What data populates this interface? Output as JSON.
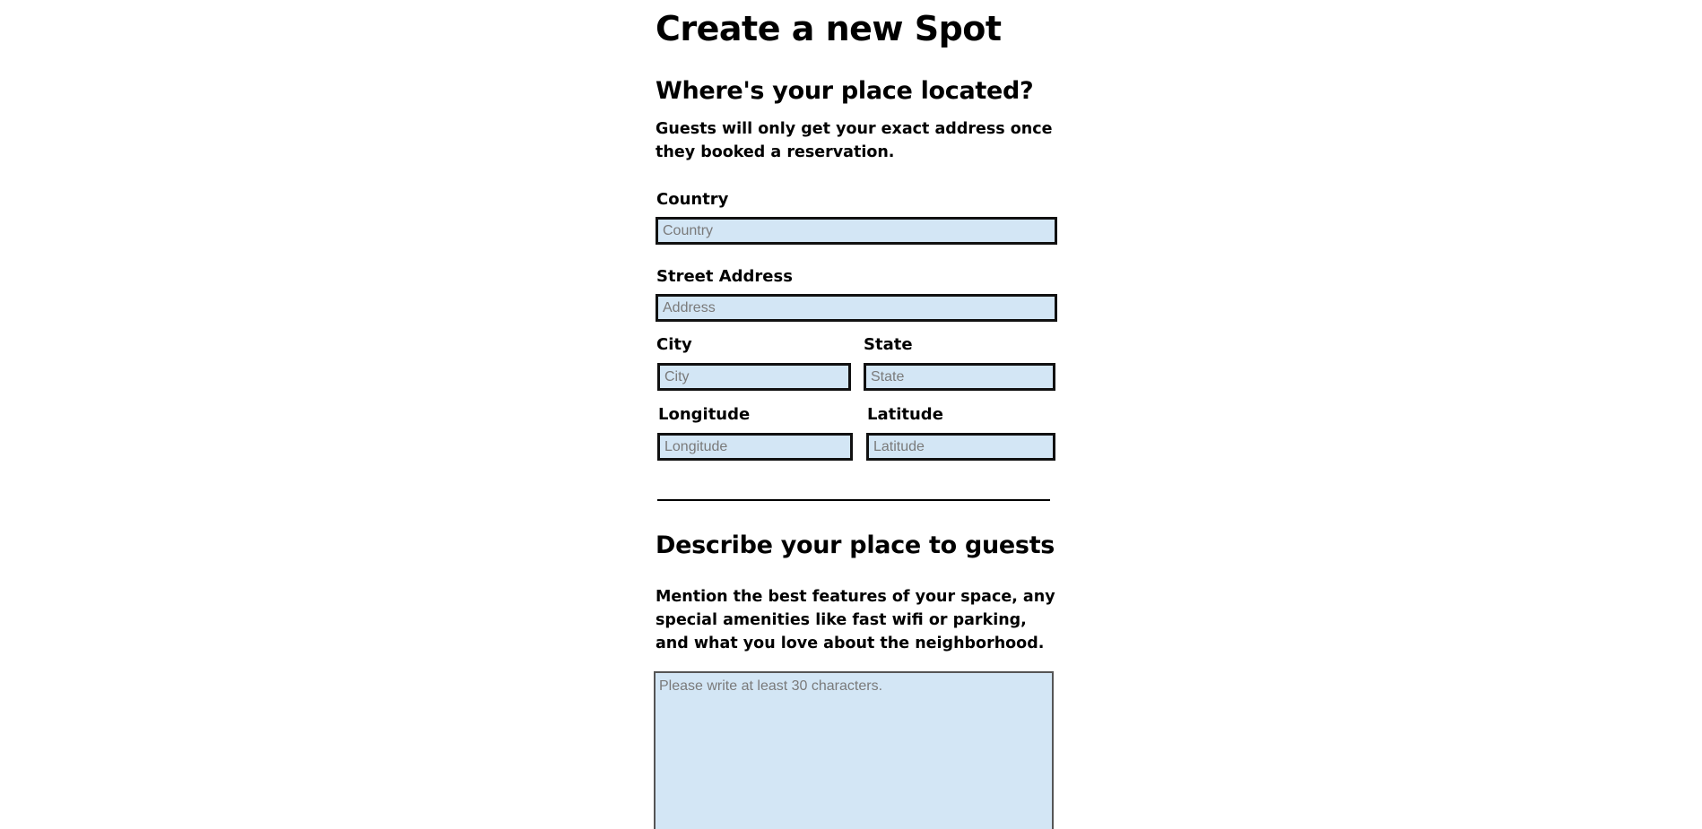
{
  "page": {
    "title": "Create a new Spot"
  },
  "location": {
    "heading": "Where's your place located?",
    "note": "Guests will only get your exact address once they booked a reservation.",
    "country": {
      "label": "Country",
      "placeholder": "Country",
      "value": ""
    },
    "address": {
      "label": "Street Address",
      "placeholder": "Address",
      "value": ""
    },
    "city": {
      "label": "City",
      "placeholder": "City",
      "value": ""
    },
    "state": {
      "label": "State",
      "placeholder": "State",
      "value": ""
    },
    "longitude": {
      "label": "Longitude",
      "placeholder": "Longitude",
      "value": ""
    },
    "latitude": {
      "label": "Latitude",
      "placeholder": "Latitude",
      "value": ""
    }
  },
  "description": {
    "heading": "Describe your place to guests",
    "note": "Mention the best features of your space, any special amenities like fast wifi or parking, and what you love about the neighborhood.",
    "placeholder": "Please write at least 30 characters.",
    "value": ""
  },
  "colors": {
    "input_background": "#d3e6f5",
    "input_border": "#111111",
    "text": "#000000"
  }
}
